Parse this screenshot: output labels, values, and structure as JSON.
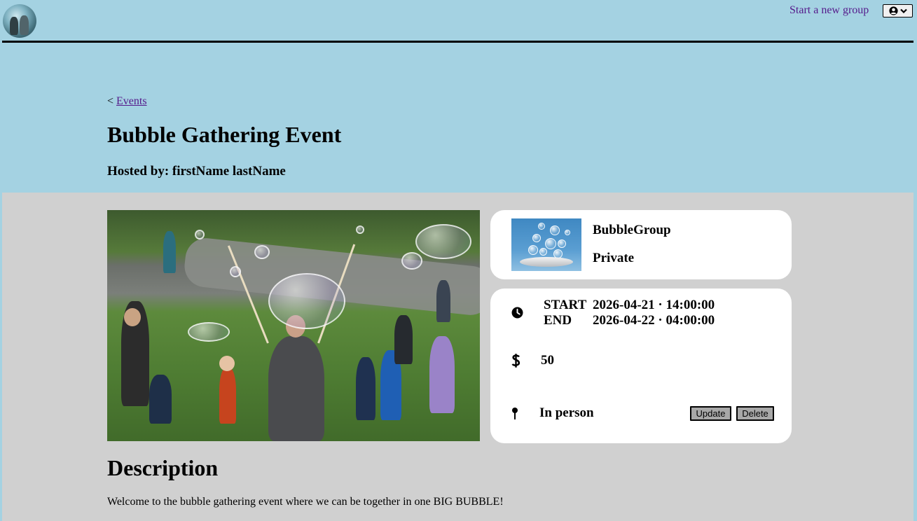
{
  "nav": {
    "start_group_link": "Start a new group"
  },
  "breadcrumb": {
    "prefix": "<",
    "link": "Events"
  },
  "event": {
    "title": "Bubble Gathering Event",
    "hosted_by": "Hosted by: firstName lastName",
    "start_label": "START",
    "start_value": "2026-04-21 · 14:00:00",
    "end_label": "END",
    "end_value": "2026-04-22 · 04:00:00",
    "price": "50",
    "type": "In person"
  },
  "group": {
    "name": "BubbleGroup",
    "privacy": "Private"
  },
  "actions": {
    "update": "Update",
    "delete": "Delete"
  },
  "description": {
    "heading": "Description",
    "text": "Welcome to the bubble gathering event where we can be together in one BIG BUBBLE!"
  },
  "icons": {
    "clock": "clock-icon",
    "price": "dollar-icon",
    "location": "pin-icon",
    "profile": "user-circle-icon",
    "chevron": "chevron-down-icon"
  },
  "colors": {
    "header_bg": "#a4d2e2",
    "content_bg": "#d0d0d0",
    "link": "#551a8b",
    "button_bg": "#a8a8a8"
  }
}
